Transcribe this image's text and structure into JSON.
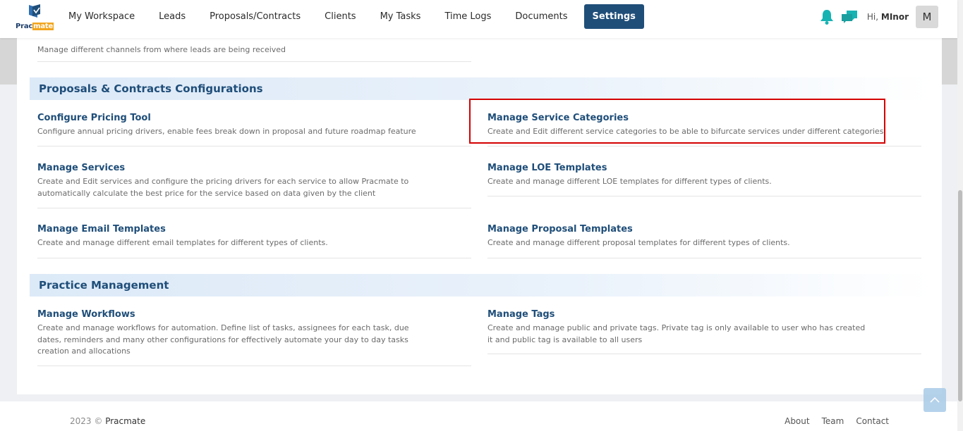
{
  "header": {
    "logo_text_a": "Prac",
    "logo_text_b": "mate",
    "nav": [
      "My Workspace",
      "Leads",
      "Proposals/Contracts",
      "Clients",
      "My Tasks",
      "Time Logs",
      "Documents",
      "Settings"
    ],
    "active_nav": "Settings",
    "greeting_prefix": "Hi,",
    "user_name": "MInor",
    "avatar_initial": "M",
    "colors": {
      "brand": "#1f4e79",
      "accent_icon": "#17b3b3"
    }
  },
  "top_fragment": {
    "description": "Manage different channels from where leads are being received"
  },
  "proposals": {
    "title": "Proposals & Contracts Configurations",
    "items": [
      {
        "title": "Configure Pricing Tool",
        "desc": "Configure annual pricing drivers, enable fees break down in proposal and future roadmap feature"
      },
      {
        "title": "Manage Service Categories",
        "desc": "Create and Edit different service categories to be able to bifurcate services under different categories"
      },
      {
        "title": "Manage Services",
        "desc": "Create and Edit services and configure the pricing drivers for each service to allow Pracmate to automatically calculate the best price for the service based on data given by the client"
      },
      {
        "title": "Manage LOE Templates",
        "desc": "Create and manage different LOE templates for different types of clients."
      },
      {
        "title": "Manage Email Templates",
        "desc": "Create and manage different email templates for different types of clients."
      },
      {
        "title": "Manage Proposal Templates",
        "desc": "Create and manage different proposal templates for different types of clients."
      }
    ]
  },
  "practice": {
    "title": "Practice Management",
    "items": [
      {
        "title": "Manage Workflows",
        "desc": "Create and manage workflows for automation. Define list of tasks, assignees for each task, due dates, reminders and many other configurations for effectively automate your day to day tasks creation and allocations"
      },
      {
        "title": "Manage Tags",
        "desc": "Create and manage public and private tags. Private tag is only available to user who has created it and public tag is available to all users"
      }
    ]
  },
  "footer": {
    "year": "2023 ©",
    "brand": "Pracmate",
    "links": [
      "About",
      "Team",
      "Contact"
    ]
  }
}
